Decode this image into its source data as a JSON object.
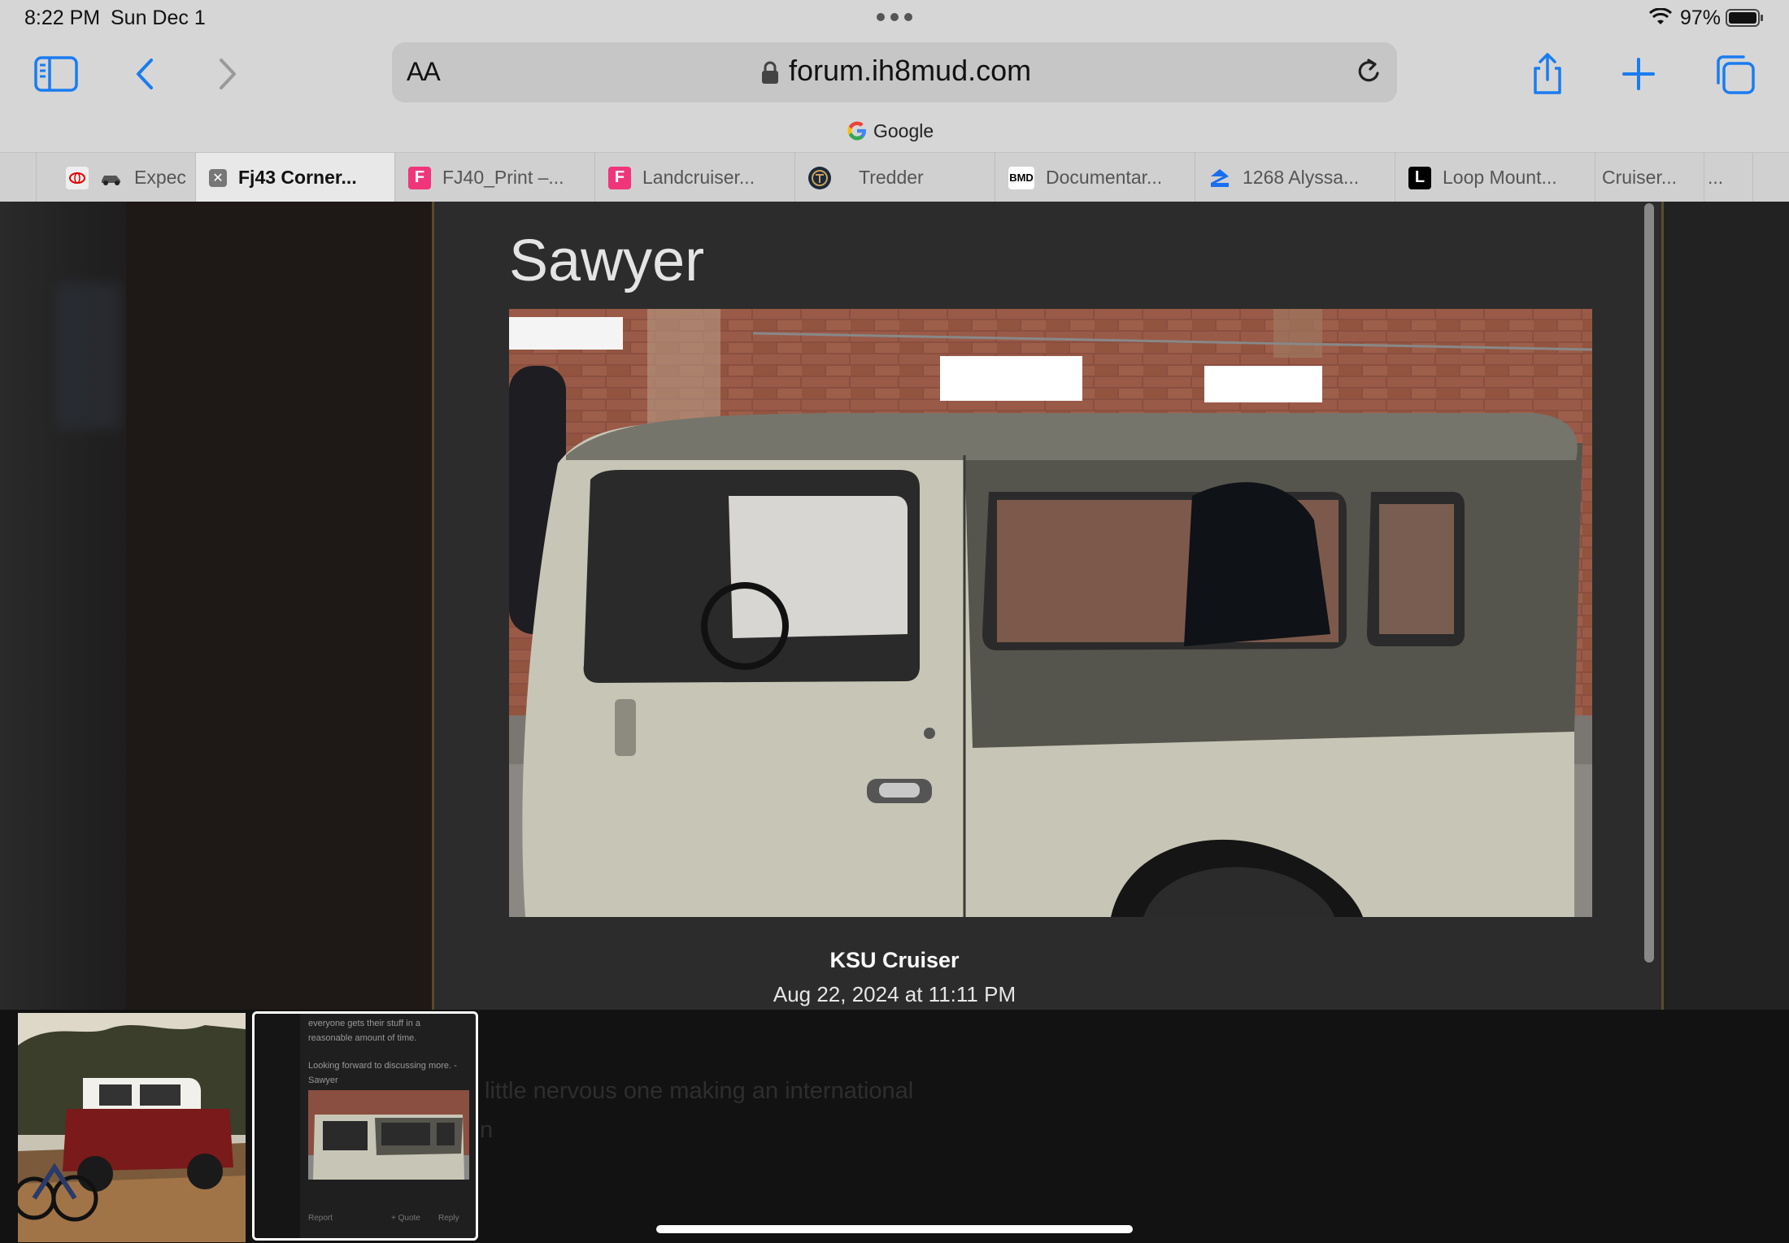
{
  "status_bar": {
    "time": "8:22 PM",
    "date": "Sun Dec 1",
    "battery_percent": "97%"
  },
  "toolbar": {
    "url": "forum.ih8mud.com",
    "aa_label": "AA",
    "search_engine_label": "Google"
  },
  "tabs": [
    {
      "label": "Expec",
      "favicon": "car-favicon",
      "active": false
    },
    {
      "label": "Fj43 Corner...",
      "favicon": "close-tab-icon",
      "active": true
    },
    {
      "label": "FJ40_Print –...",
      "favicon": "F",
      "active": false
    },
    {
      "label": "Landcruiser...",
      "favicon": "F",
      "active": false
    },
    {
      "label": "Tredder",
      "favicon": "tredder-logo",
      "active": false
    },
    {
      "label": "Documentar...",
      "favicon": "BMD",
      "active": false
    },
    {
      "label": "1268 Alyssa...",
      "favicon": "zillow-logo",
      "active": false
    },
    {
      "label": "Loop Mount...",
      "favicon": "L",
      "active": false
    },
    {
      "label": "Cruiser...",
      "favicon": "",
      "active": false
    },
    {
      "label": "...",
      "favicon": "",
      "active": false
    }
  ],
  "lightbox": {
    "post_text": "Sawyer",
    "author": "KSU Cruiser",
    "date": "Aug 22, 2024 at 11:11 PM",
    "background_text_1": "little nervous one making an international",
    "background_text_2": "n"
  },
  "thumbnail_2": {
    "line_1": "everyone gets their stuff in a",
    "line_2": "reasonable amount of time.",
    "line_3": "Looking forward to discussing more. -",
    "line_4": "Sawyer",
    "report": "Report",
    "quote": "+ Quote",
    "reply": "Reply"
  },
  "colors": {
    "safari_chrome": "#d6d6d6",
    "accent_blue": "#1a7cf0",
    "lightbox_bg": "#1a1a1a"
  }
}
